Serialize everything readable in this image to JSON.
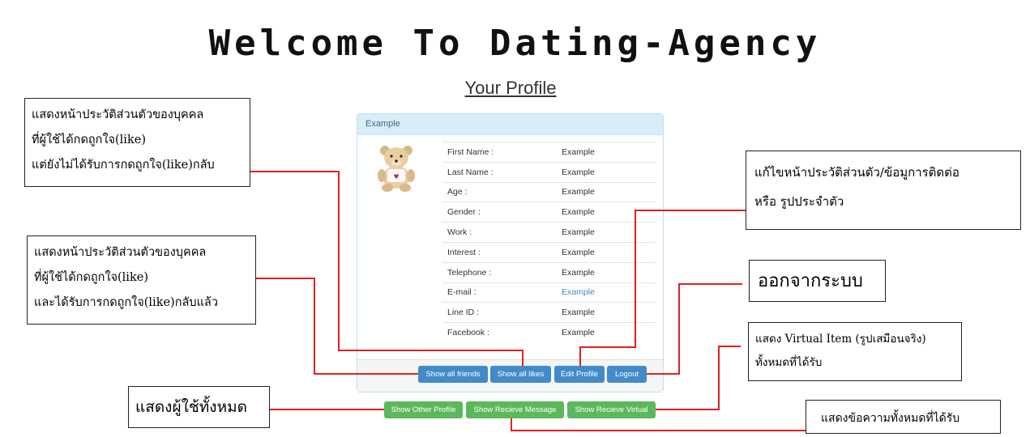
{
  "page": {
    "title": "Welcome To Dating-Agency",
    "subtitle": "Your Profile"
  },
  "profile": {
    "header": "Example",
    "avatar_icon": "teddy-bear-avatar",
    "fields": [
      {
        "label": "First Name :",
        "value": "Example"
      },
      {
        "label": "Last Name :",
        "value": "Example"
      },
      {
        "label": "Age :",
        "value": "Example"
      },
      {
        "label": "Gender :",
        "value": "Example"
      },
      {
        "label": "Work :",
        "value": "Example"
      },
      {
        "label": "Interest :",
        "value": "Example"
      },
      {
        "label": "Telephone :",
        "value": "Example"
      },
      {
        "label": "E-mail :",
        "value": "Example"
      },
      {
        "label": "Line ID :",
        "value": "Example"
      },
      {
        "label": "Facebook :",
        "value": "Example"
      }
    ]
  },
  "buttons": {
    "show_all_friends": "Show all friends",
    "show_all_likes": "Show all likes",
    "edit_profile": "Edit Profile",
    "logout": "Logout",
    "show_other_profile": "Show Other Profile",
    "show_recieve_message": "Show Recieve Message",
    "show_recieve_virtual": "Show Recieve Virtual"
  },
  "annotations": {
    "liked_not_returned": [
      "แสดงหน้าประวัติส่วนตัวของบุคคล",
      "ที่ผู้ใช้ได้กดถูกใจ(like)",
      "แต่ยังไม่ได้รับการกดถูกใจ(like)กลับ"
    ],
    "liked_and_returned": [
      "แสดงหน้าประวัติส่วนตัวของบุคคล",
      "ที่ผู้ใช้ได้กดถูกใจ(like)",
      "และได้รับการกดถูกใจ(like)กลับแล้ว"
    ],
    "show_all_users": "แสดงผู้ใช้ทั้งหมด",
    "edit_profile": [
      "แก้ไขหน้าประวัติส่วนตัว/ข้อมูการติดต่อ",
      "หรือ รูปประจำตัว"
    ],
    "logout": "ออกจากระบบ",
    "virtual_items": [
      "แสดง Virtual Item (รูปเสมือนจริง)",
      "ทั้งหมดที่ได้รับ"
    ],
    "messages": "แสดงข้อความทั้งหมดที่ได้รับ"
  },
  "colors": {
    "callout_line": "#e32020",
    "panel_header_bg": "#d9edf7",
    "button_blue": "#428bca",
    "button_green": "#5cb85c",
    "email_link": "#428bca"
  }
}
